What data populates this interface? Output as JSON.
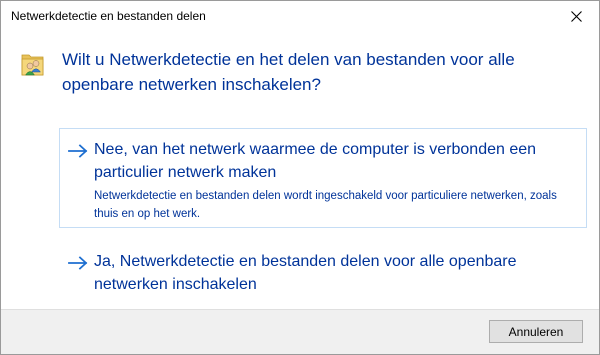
{
  "window": {
    "title": "Netwerkdetectie en bestanden delen"
  },
  "header": {
    "icon": "network-users-icon",
    "question": "Wilt u Netwerkdetectie en het delen van bestanden voor alle openbare netwerken inschakelen?"
  },
  "options": [
    {
      "icon": "arrow-right-icon",
      "label": "Nee, van het netwerk waarmee de computer is verbonden een particulier netwerk maken",
      "description": "Netwerkdetectie en bestanden delen wordt ingeschakeld voor particuliere netwerken, zoals thuis en op het werk."
    },
    {
      "icon": "arrow-right-icon",
      "label": "Ja, Netwerkdetectie en bestanden delen voor alle openbare netwerken inschakelen"
    }
  ],
  "footer": {
    "cancel_label": "Annuleren"
  },
  "colors": {
    "link_blue": "#003399",
    "arrow_blue": "#1e6fd0",
    "selection_border": "#c5ddf5",
    "footer_bg": "#f0f0f0"
  }
}
